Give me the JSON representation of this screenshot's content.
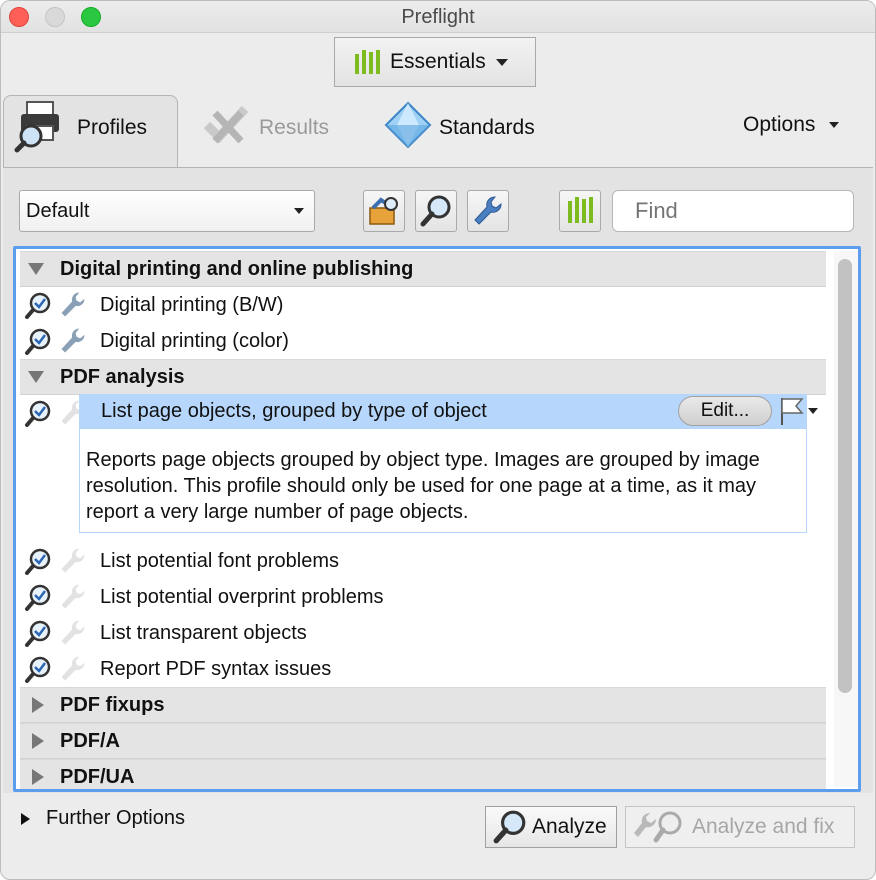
{
  "window": {
    "title": "Preflight"
  },
  "toolbar": {
    "mode_label": "Essentials"
  },
  "tabs": [
    {
      "label": "Profiles",
      "icon": "printer-magnifier-icon",
      "active": true
    },
    {
      "label": "Results",
      "icon": "results-icon",
      "enabled": false
    },
    {
      "label": "Standards",
      "icon": "diamond-icon"
    }
  ],
  "options": {
    "label": "Options"
  },
  "filter": {
    "profile_set": "Default",
    "find_placeholder": "Find"
  },
  "groups": [
    {
      "label": "Digital printing and online publishing",
      "expanded": true,
      "items": [
        {
          "label": "Digital printing (B/W)"
        },
        {
          "label": "Digital printing (color)"
        }
      ]
    },
    {
      "label": "PDF analysis",
      "expanded": true,
      "items": [
        {
          "label": "List page objects, grouped by type of object",
          "selected": true,
          "description": "Reports page objects grouped by object type. Images are grouped by image resolution. This profile should only be used for one page at a time, as it may report a very large number of page objects."
        },
        {
          "label": "List potential font problems"
        },
        {
          "label": "List potential overprint problems"
        },
        {
          "label": "List transparent objects"
        },
        {
          "label": "Report PDF syntax issues"
        }
      ]
    },
    {
      "label": "PDF fixups",
      "expanded": false
    },
    {
      "label": "PDF/A",
      "expanded": false
    },
    {
      "label": "PDF/UA",
      "expanded": false
    }
  ],
  "selected_actions": {
    "edit_label": "Edit..."
  },
  "footer": {
    "further_options": "Further Options",
    "analyze": "Analyze",
    "analyze_fix": "Analyze and fix"
  },
  "colors": {
    "accent": "#5b9ef0",
    "selection": "#b6d6fb",
    "green_bars": "#7dbb1f"
  }
}
